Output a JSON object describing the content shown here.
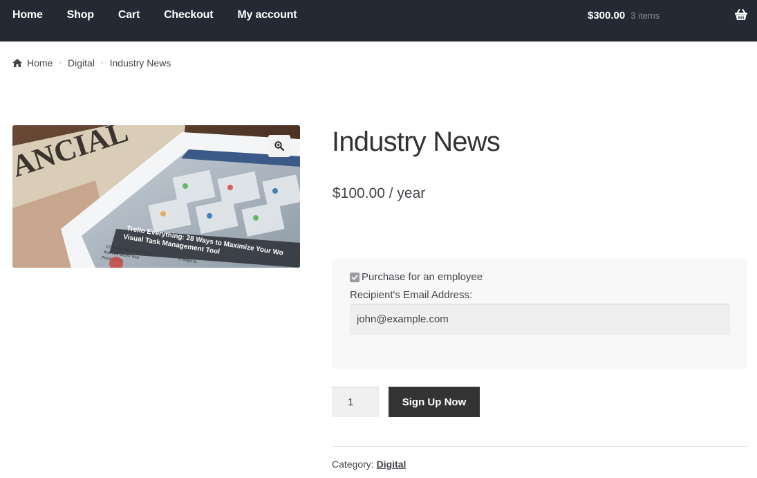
{
  "header": {
    "nav": [
      "Home",
      "Shop",
      "Cart",
      "Checkout",
      "My account"
    ],
    "cart_total": "$300.00",
    "cart_count": "3 items",
    "basket_icon": "basket-icon"
  },
  "breadcrumb": {
    "home_icon": "home-icon",
    "items": [
      "Home",
      "Digital",
      "Industry News"
    ]
  },
  "product": {
    "title": "Industry News",
    "price": "$100.00 / year",
    "zoom_icon": "zoom-in-icon",
    "employee_checkbox_label": "Purchase for an employee",
    "employee_checked": true,
    "email_label": "Recipient's Email Address:",
    "email_value": "john@example.com",
    "quantity": "1",
    "signup_label": "Sign Up Now",
    "category_label": "Category:",
    "category_value": "Digital"
  },
  "image_text": {
    "newspaper_masthead": "ANCIAL",
    "tablet_headline": "Trello Everything: 28 Ways to Maximize Your Wo",
    "tablet_headline_2": "Visual Task Management Tool",
    "tablet_article_2": "12 Pomodoro Timer Apps",
    "tablet_article_2b": "that Will Boost Your",
    "tablet_article_2c": "Productivity",
    "tablet_article_3": "5 Ways to"
  },
  "colors": {
    "header_bg": "#232a33",
    "button_bg": "#333333",
    "panel_bg": "#f8f8f8"
  }
}
